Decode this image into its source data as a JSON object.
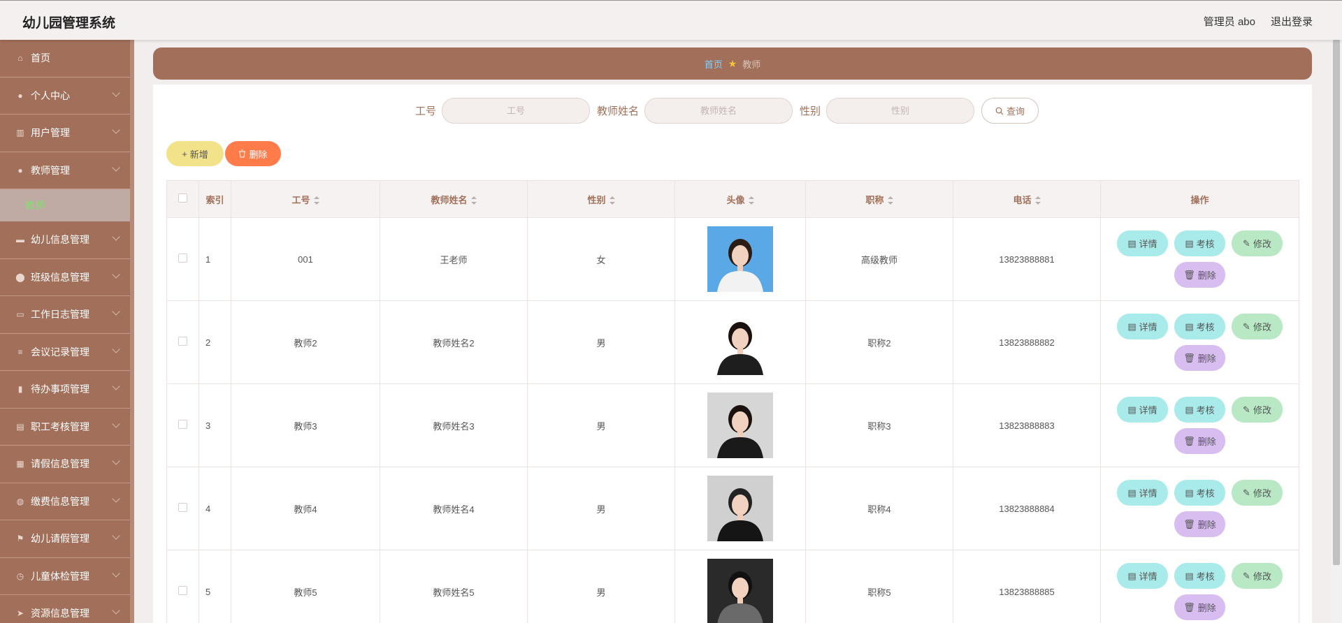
{
  "header": {
    "brand": "幼儿园管理系统",
    "user": "管理员 abo",
    "logout": "退出登录"
  },
  "sidebar": {
    "items": [
      {
        "label": "首页",
        "icon": "home-icon",
        "expandable": false
      },
      {
        "label": "个人中心",
        "icon": "user-icon",
        "expandable": true
      },
      {
        "label": "用户管理",
        "icon": "building-icon",
        "expandable": true
      },
      {
        "label": "教师管理",
        "icon": "user-icon",
        "expandable": true
      },
      {
        "label": "幼儿信息管理",
        "icon": "briefcase-icon",
        "expandable": true
      },
      {
        "label": "班级信息管理",
        "icon": "location-icon",
        "expandable": true
      },
      {
        "label": "工作日志管理",
        "icon": "chat-icon",
        "expandable": true
      },
      {
        "label": "会议记录管理",
        "icon": "list-icon",
        "expandable": true
      },
      {
        "label": "待办事项管理",
        "icon": "bar-chart-icon",
        "expandable": true
      },
      {
        "label": "职工考核管理",
        "icon": "clipboard-icon",
        "expandable": true
      },
      {
        "label": "请假信息管理",
        "icon": "grid-icon",
        "expandable": true
      },
      {
        "label": "缴费信息管理",
        "icon": "globe-icon",
        "expandable": true
      },
      {
        "label": "幼儿请假管理",
        "icon": "flag-icon",
        "expandable": true
      },
      {
        "label": "儿童体检管理",
        "icon": "clock-icon",
        "expandable": true
      },
      {
        "label": "资源信息管理",
        "icon": "send-icon",
        "expandable": true
      }
    ],
    "active_sub": "教师"
  },
  "breadcrumb": {
    "home": "首页",
    "current": "教师"
  },
  "search": {
    "fields": [
      {
        "label": "工号",
        "placeholder": "工号"
      },
      {
        "label": "教师姓名",
        "placeholder": "教师姓名"
      },
      {
        "label": "性别",
        "placeholder": "性别"
      }
    ],
    "query_label": "查询"
  },
  "toolbar": {
    "add_label": "新增",
    "delete_label": "删除"
  },
  "table": {
    "columns": [
      "索引",
      "工号",
      "教师姓名",
      "性别",
      "头像",
      "职称",
      "电话",
      "操作"
    ],
    "rows": [
      {
        "index": "1",
        "id": "001",
        "name": "王老师",
        "gender": "女",
        "title": "高级教师",
        "phone": "13823888881"
      },
      {
        "index": "2",
        "id": "教师2",
        "name": "教师姓名2",
        "gender": "男",
        "title": "职称2",
        "phone": "13823888882"
      },
      {
        "index": "3",
        "id": "教师3",
        "name": "教师姓名3",
        "gender": "男",
        "title": "职称3",
        "phone": "13823888883"
      },
      {
        "index": "4",
        "id": "教师4",
        "name": "教师姓名4",
        "gender": "男",
        "title": "职称4",
        "phone": "13823888884"
      },
      {
        "index": "5",
        "id": "教师5",
        "name": "教师姓名5",
        "gender": "男",
        "title": "职称5",
        "phone": "13823888885"
      }
    ],
    "ops": {
      "detail": "详情",
      "check": "考核",
      "edit": "修改",
      "delete": "删除"
    }
  },
  "colors": {
    "accent": "#a2705a",
    "active_submenu_text": "#7ee06e",
    "add_button": "#f2e38a",
    "delete_button": "#ff7b4a",
    "op_detail": "#a9ebea",
    "op_edit": "#b9e8c5",
    "op_delete": "#d8bdf0"
  }
}
